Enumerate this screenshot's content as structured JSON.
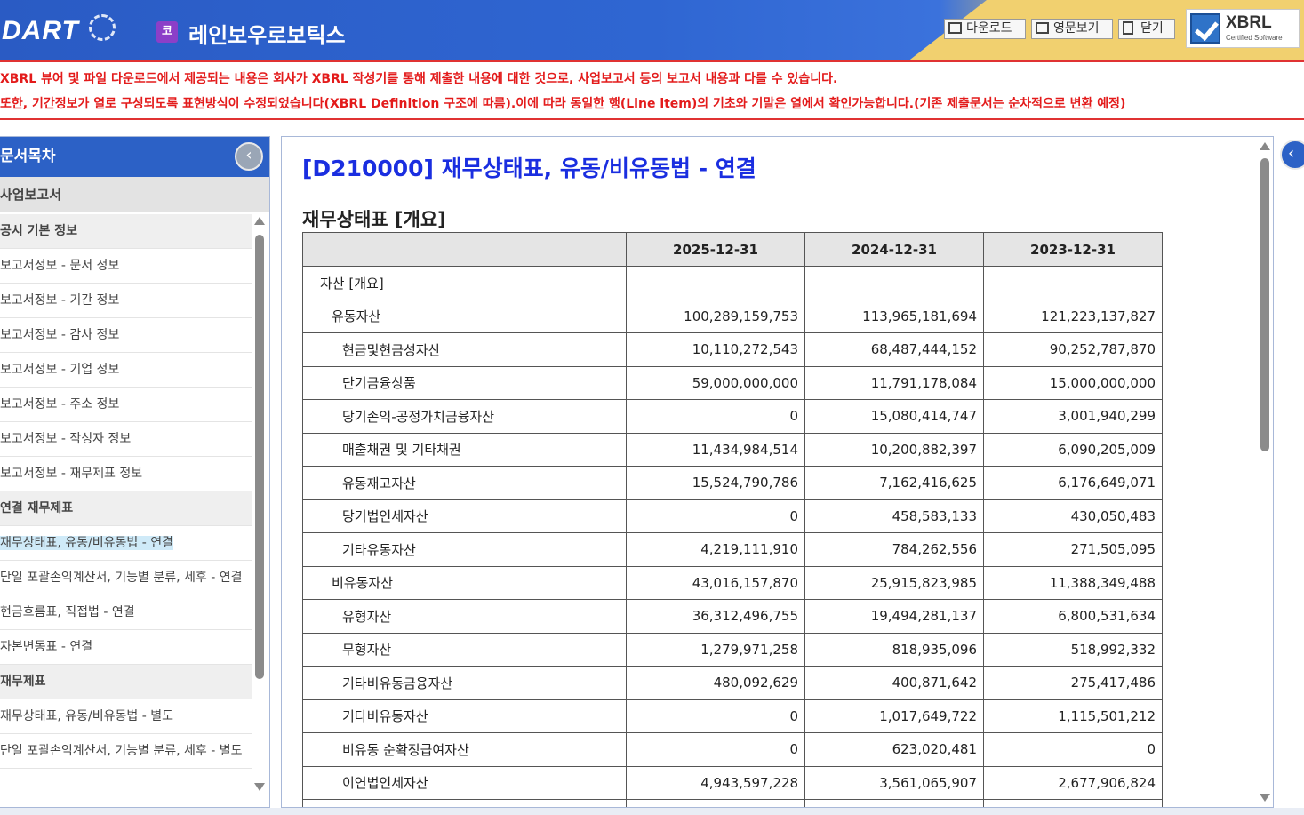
{
  "header": {
    "logo_text": "DART",
    "corp_badge": "코",
    "corp_name": "레인보우로보틱스",
    "download_label": "다운로드",
    "english_label": "영문보기",
    "close_label": "닫기",
    "xbrl_title": "XBRL",
    "xbrl_subtitle": "Certified Software"
  },
  "notice": {
    "line1": "XBRL 뷰어 및 파일 다운로드에서 제공되는 내용은 회사가 XBRL 작성기를 통해 제출한 내용에 대한 것으로, 사업보고서 등의 보고서 내용과 다를 수 있습니다.",
    "line2": "또한, 기간정보가 열로 구성되도록 표현방식이 수정되었습니다(XBRL Definition 구조에 따름).이에 따라 동일한 행(Line item)의 기초와 기말은 열에서 확인가능합니다.(기존 제출문서는 순차적으로 변환 예정)"
  },
  "sidebar": {
    "title": "문서목차",
    "collapse_icon": "‹",
    "report": "사업보고서",
    "items": [
      {
        "label": "공시 기본 정보",
        "type": "group"
      },
      {
        "label": "보고서정보 - 문서 정보",
        "type": "item"
      },
      {
        "label": "보고서정보 - 기간 정보",
        "type": "item"
      },
      {
        "label": "보고서정보 - 감사 정보",
        "type": "item"
      },
      {
        "label": "보고서정보 - 기업 정보",
        "type": "item"
      },
      {
        "label": "보고서정보 - 주소 정보",
        "type": "item"
      },
      {
        "label": "보고서정보 - 작성자 정보",
        "type": "item"
      },
      {
        "label": "보고서정보 - 재무제표 정보",
        "type": "item"
      },
      {
        "label": "연결 재무제표",
        "type": "group"
      },
      {
        "label": "재무상태표, 유동/비유동법 - 연결",
        "type": "item",
        "selected": true
      },
      {
        "label": "단일 포괄손익계산서, 기능별 분류, 세후 - 연결",
        "type": "item"
      },
      {
        "label": "현금흐름표, 직접법 - 연결",
        "type": "item"
      },
      {
        "label": "자본변동표 - 연결",
        "type": "item"
      },
      {
        "label": "재무제표",
        "type": "group"
      },
      {
        "label": "재무상태표, 유동/비유동법 - 별도",
        "type": "item"
      },
      {
        "label": "단일 포괄손익계산서, 기능별 분류, 세후 - 별도",
        "type": "item"
      }
    ]
  },
  "main": {
    "title": "[D210000] 재무상태표, 유동/비유동법 - 연결",
    "section_title": "재무상태표 [개요]",
    "columns": [
      "",
      "2025-12-31",
      "2024-12-31",
      "2023-12-31"
    ],
    "rows": [
      {
        "label": "자산 [개요]",
        "level": 0,
        "values": [
          "",
          "",
          ""
        ]
      },
      {
        "label": "유동자산",
        "level": 1,
        "values": [
          "100,289,159,753",
          "113,965,181,694",
          "121,223,137,827"
        ]
      },
      {
        "label": "현금및현금성자산",
        "level": 2,
        "values": [
          "10,110,272,543",
          "68,487,444,152",
          "90,252,787,870"
        ]
      },
      {
        "label": "단기금융상품",
        "level": 2,
        "values": [
          "59,000,000,000",
          "11,791,178,084",
          "15,000,000,000"
        ]
      },
      {
        "label": "당기손익-공정가치금융자산",
        "level": 2,
        "values": [
          "0",
          "15,080,414,747",
          "3,001,940,299"
        ]
      },
      {
        "label": "매출채권 및 기타채권",
        "level": 2,
        "values": [
          "11,434,984,514",
          "10,200,882,397",
          "6,090,205,009"
        ]
      },
      {
        "label": "유동재고자산",
        "level": 2,
        "values": [
          "15,524,790,786",
          "7,162,416,625",
          "6,176,649,071"
        ]
      },
      {
        "label": "당기법인세자산",
        "level": 2,
        "values": [
          "0",
          "458,583,133",
          "430,050,483"
        ]
      },
      {
        "label": "기타유동자산",
        "level": 2,
        "values": [
          "4,219,111,910",
          "784,262,556",
          "271,505,095"
        ]
      },
      {
        "label": "비유동자산",
        "level": 1,
        "values": [
          "43,016,157,870",
          "25,915,823,985",
          "11,388,349,488"
        ]
      },
      {
        "label": "유형자산",
        "level": 2,
        "values": [
          "36,312,496,755",
          "19,494,281,137",
          "6,800,531,634"
        ]
      },
      {
        "label": "무형자산",
        "level": 2,
        "values": [
          "1,279,971,258",
          "818,935,096",
          "518,992,332"
        ]
      },
      {
        "label": "기타비유동금융자산",
        "level": 2,
        "values": [
          "480,092,629",
          "400,871,642",
          "275,417,486"
        ]
      },
      {
        "label": "기타비유동자산",
        "level": 2,
        "values": [
          "0",
          "1,017,649,722",
          "1,115,501,212"
        ]
      },
      {
        "label": "비유동 순확정급여자산",
        "level": 2,
        "values": [
          "0",
          "623,020,481",
          "0"
        ]
      },
      {
        "label": "이연법인세자산",
        "level": 2,
        "values": [
          "4,943,597,228",
          "3,561,065,907",
          "2,677,906,824"
        ]
      },
      {
        "label": "",
        "level": 2,
        "values": [
          "",
          "",
          ""
        ]
      }
    ]
  },
  "right_expand_icon": "‹",
  "colors": {
    "header_blue": "#2f66d2",
    "notice_red": "#e31b1b",
    "title_blue": "#1a2ee0",
    "sidebar_head": "#2c61c6"
  }
}
